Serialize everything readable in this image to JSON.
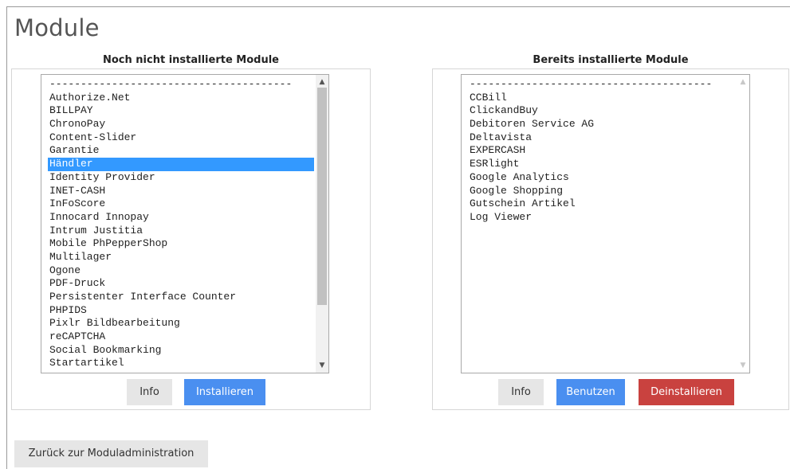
{
  "page": {
    "title": "Module"
  },
  "left_panel": {
    "heading": "Noch nicht installierte Module",
    "options": [
      "---------------------------------------",
      "Authorize.Net",
      "BILLPAY",
      "ChronoPay",
      "Content-Slider",
      "Garantie",
      "Händler",
      "Identity Provider",
      "INET-CASH",
      "InFoScore",
      "Innocard Innopay",
      "Intrum Justitia",
      "Mobile PhPepperShop",
      "Multilager",
      "Ogone",
      "PDF-Druck",
      "Persistenter Interface Counter",
      "PHPIDS",
      "Pixlr Bildbearbeitung",
      "reCAPTCHA",
      "Social Bookmarking",
      "Startartikel"
    ],
    "selected": "Händler",
    "info_label": "Info",
    "install_label": "Installieren"
  },
  "right_panel": {
    "heading": "Bereits installierte Module",
    "options": [
      "---------------------------------------",
      "CCBill",
      "ClickandBuy",
      "Debitoren Service AG",
      "Deltavista",
      "EXPERCASH",
      "ESRlight",
      "Google Analytics",
      "Google Shopping",
      "Gutschein Artikel",
      "Log Viewer"
    ],
    "info_label": "Info",
    "use_label": "Benutzen",
    "uninstall_label": "Deinstallieren"
  },
  "footer": {
    "back_label": "Zurück zur Moduladministration"
  },
  "icons": {
    "scroll_up": "▲",
    "scroll_down": "▼"
  },
  "colors": {
    "selection": "#3399ff",
    "primary_button": "#4a8ff0",
    "danger_button": "#c9423f"
  }
}
